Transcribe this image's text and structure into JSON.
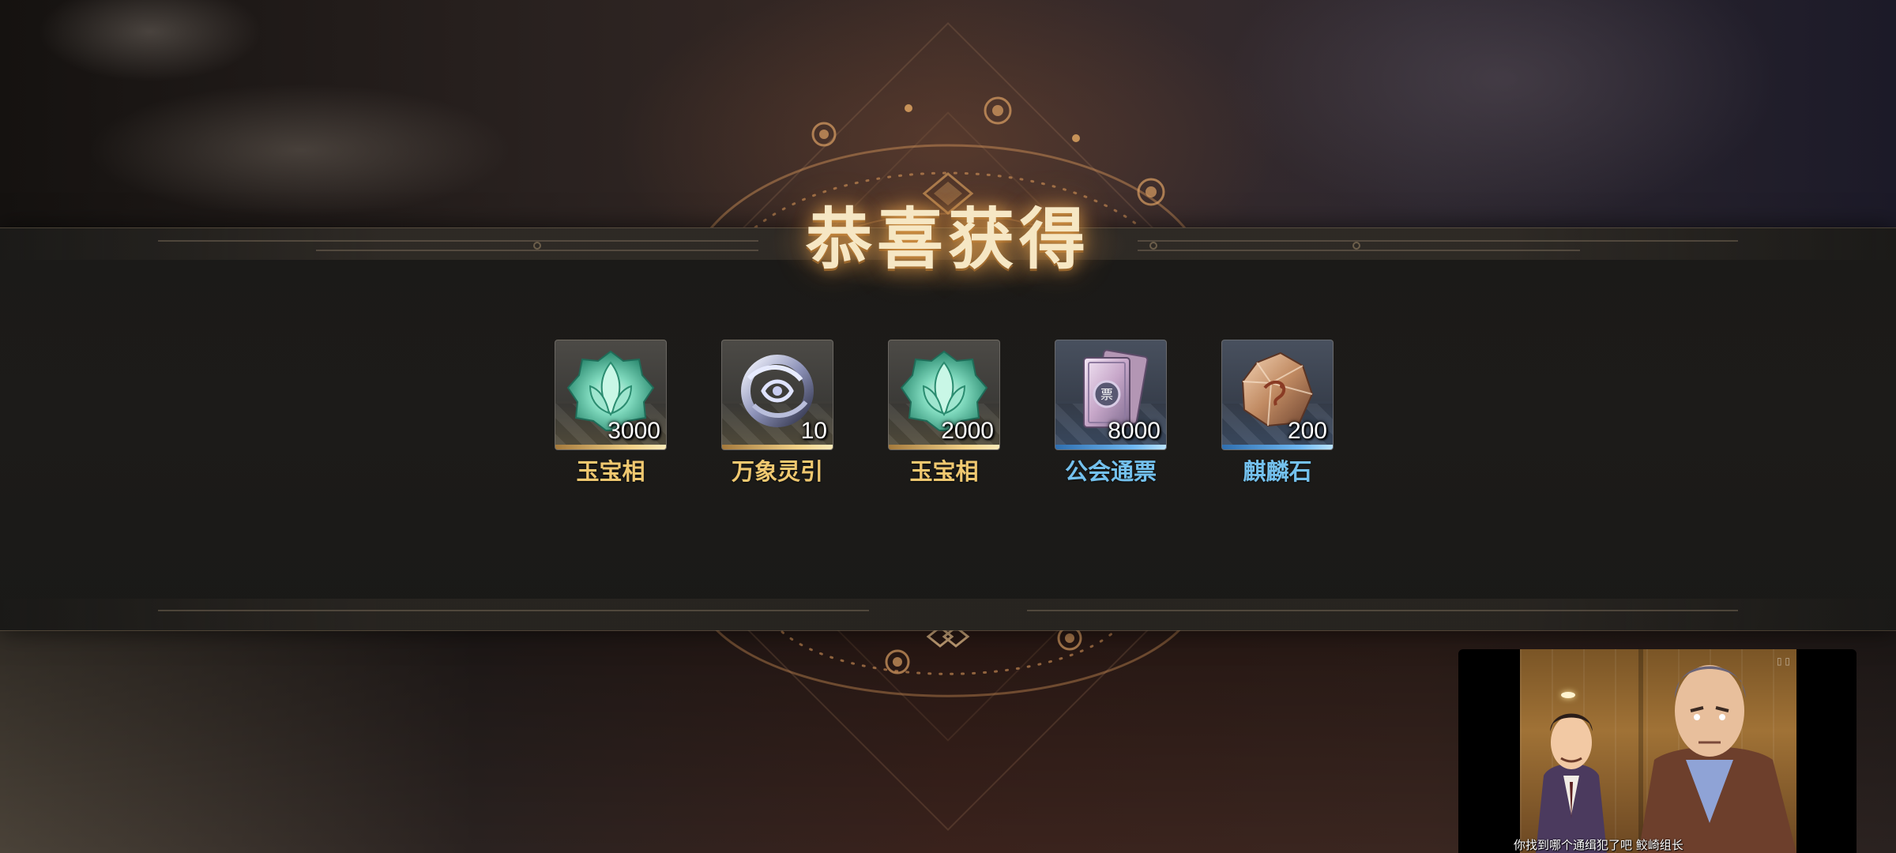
{
  "title": "恭喜获得",
  "rewards": [
    {
      "name": "玉宝相",
      "count": "3000",
      "rarity": "gold",
      "icon": "jade-lotus-icon"
    },
    {
      "name": "万象灵引",
      "count": "10",
      "rarity": "gold",
      "icon": "spirit-ring-icon"
    },
    {
      "name": "玉宝相",
      "count": "2000",
      "rarity": "gold",
      "icon": "jade-lotus-icon"
    },
    {
      "name": "公会通票",
      "count": "8000",
      "rarity": "blue",
      "icon": "guild-ticket-icon"
    },
    {
      "name": "麒麟石",
      "count": "200",
      "rarity": "blue",
      "icon": "qilin-stone-icon"
    }
  ],
  "pip": {
    "subtitle": "你找到哪个通缉犯了吧 鲛崎组长"
  },
  "colors": {
    "gold_text": "#f0c870",
    "blue_text": "#74c1ee",
    "title_text": "#f6e7c4"
  }
}
